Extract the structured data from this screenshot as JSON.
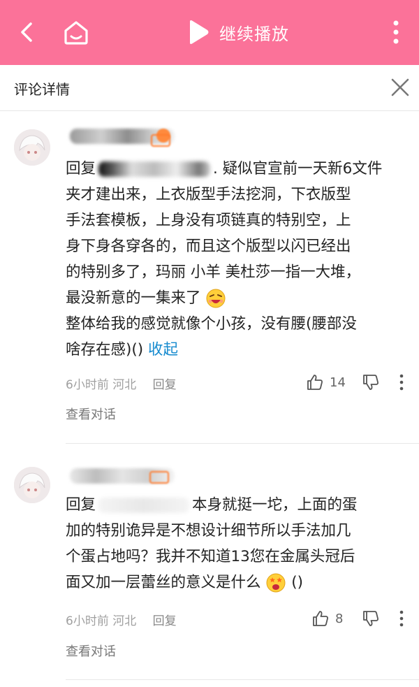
{
  "colors": {
    "accent": "#fb7299",
    "link": "#178bcf"
  },
  "topbar": {
    "back_icon": "chevron-left-icon",
    "home_icon": "home-tv-icon",
    "play_icon": "play-icon",
    "title": "继续播放",
    "more_icon": "more-vertical-icon"
  },
  "subheader": {
    "title": "评论详情",
    "close_icon": "close-icon"
  },
  "comments": [
    {
      "reply_prefix": "回复",
      "lines": [
        ". 疑似官宣前一天新6文件",
        "夹才建出来，上衣版型手法挖洞，下衣版型",
        "手法套模板，上身没有项链真的特别空，上",
        "身下身各穿各的，而且这个版型以闪已经出",
        "的特别多了，玛丽 小羊 美杜莎一指一大堆，",
        "最没新意的一集来了",
        "整体给我的感觉就像个小孩，没有腰(腰部没",
        "啥存在感)()"
      ],
      "collapse_link": "收起",
      "time": "6小时前",
      "location": "河北",
      "reply_label": "回复",
      "likes": "14",
      "view_convo": "查看对话"
    },
    {
      "reply_prefix": "回复",
      "lines": [
        "本身就挺一坨，上面的蛋",
        "加的特别诡异是不想设计细节所以手法加几",
        "个蛋占地吗？我并不知道13您在金属头冠后",
        "面又加一层蕾丝的意义是什么",
        "()"
      ],
      "time": "6小时前",
      "location": "河北",
      "reply_label": "回复",
      "likes": "8",
      "view_convo": "查看对话"
    }
  ]
}
